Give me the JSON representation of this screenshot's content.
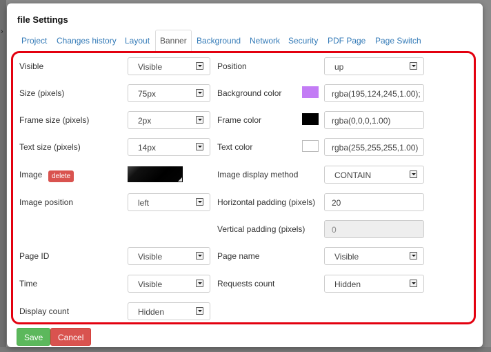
{
  "dialog": {
    "title": "file Settings"
  },
  "tabs": [
    "Project",
    "Changes history",
    "Layout",
    "Banner",
    "Background",
    "Network",
    "Security",
    "PDF Page",
    "Page Switch"
  ],
  "active_tab": "Banner",
  "left": {
    "visible": {
      "label": "Visible",
      "value": "Visible"
    },
    "size": {
      "label": "Size (pixels)",
      "value": "75px"
    },
    "frame_size": {
      "label": "Frame size (pixels)",
      "value": "2px"
    },
    "text_size": {
      "label": "Text size (pixels)",
      "value": "14px"
    },
    "image": {
      "label": "Image",
      "delete_label": "delete"
    },
    "image_position": {
      "label": "Image position",
      "value": "left"
    },
    "page_id": {
      "label": "Page ID",
      "value": "Visible"
    },
    "time": {
      "label": "Time",
      "value": "Visible"
    },
    "display_count": {
      "label": "Display count",
      "value": "Hidden"
    }
  },
  "right": {
    "position": {
      "label": "Position",
      "value": "up"
    },
    "background_color": {
      "label": "Background color",
      "value": "rgba(195,124,245,1.00);",
      "swatch": "#c37cf5"
    },
    "frame_color": {
      "label": "Frame color",
      "value": "rgba(0,0,0,1.00)",
      "swatch": "#000000"
    },
    "text_color": {
      "label": "Text color",
      "value": "rgba(255,255,255,1.00)",
      "swatch": "#ffffff"
    },
    "image_display_method": {
      "label": "Image display method",
      "value": "CONTAIN"
    },
    "horizontal_padding": {
      "label": "Horizontal padding (pixels)",
      "value": "20"
    },
    "vertical_padding": {
      "label": "Vertical padding (pixels)",
      "value": "0"
    },
    "page_name": {
      "label": "Page name",
      "value": "Visible"
    },
    "requests_count": {
      "label": "Requests count",
      "value": "Hidden"
    }
  },
  "buttons": {
    "save": "Save",
    "cancel": "Cancel"
  },
  "colors": {
    "highlight": "#e3000f",
    "tab_link": "#337ab7",
    "save": "#5cb85c",
    "cancel": "#d9534f"
  }
}
